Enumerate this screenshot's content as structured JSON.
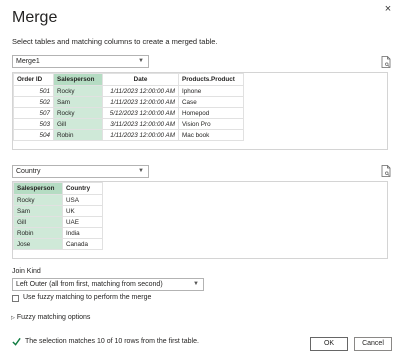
{
  "dialog": {
    "title": "Merge",
    "subtitle": "Select tables and matching columns to create a merged table.",
    "close_glyph": "×"
  },
  "table1": {
    "selected": "Merge1",
    "columns": [
      "Order ID",
      "Salesperson",
      "Date",
      "Products.Product"
    ],
    "rows": [
      [
        "501",
        "Rocky",
        "1/11/2023 12:00:00 AM",
        "Iphone"
      ],
      [
        "502",
        "Sam",
        "1/11/2023 12:00:00 AM",
        "Case"
      ],
      [
        "507",
        "Rocky",
        "5/12/2023 12:00:00 AM",
        "Homepod"
      ],
      [
        "503",
        "Gill",
        "3/11/2023 12:00:00 AM",
        "Vision Pro"
      ],
      [
        "504",
        "Robin",
        "1/11/2023 12:00:00 AM",
        "Mac book"
      ]
    ]
  },
  "table2": {
    "selected": "Country",
    "columns": [
      "Salesperson",
      "Country"
    ],
    "rows": [
      [
        "Rocky",
        "USA"
      ],
      [
        "Sam",
        "UK"
      ],
      [
        "Gill",
        "UAE"
      ],
      [
        "Robin",
        "India"
      ],
      [
        "Jose",
        "Canada"
      ]
    ]
  },
  "join": {
    "label": "Join Kind",
    "selected": "Left Outer (all from first, matching from second)"
  },
  "fuzzy": {
    "checkbox_label": "Use fuzzy matching to perform the merge",
    "options_label": "Fuzzy matching options"
  },
  "status": {
    "text": "The selection matches 10 of 10 rows from the first table."
  },
  "buttons": {
    "ok": "OK",
    "cancel": "Cancel"
  },
  "colors": {
    "selected_column": "#cfe9d8",
    "success": "#107c41"
  }
}
